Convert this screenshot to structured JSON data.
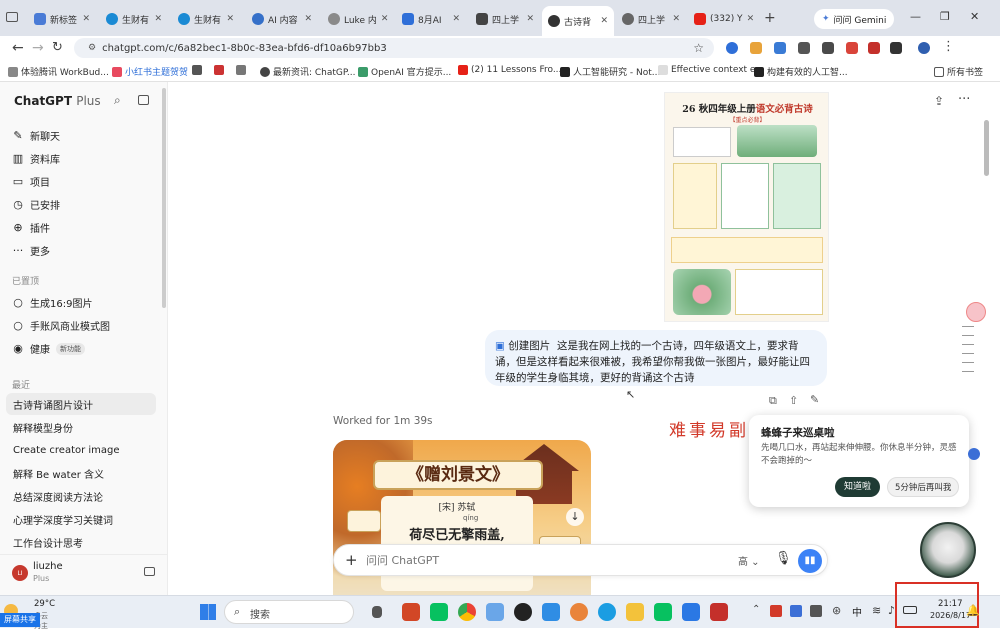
{
  "tabs": [
    {
      "label": "新标签"
    },
    {
      "label": "生财有"
    },
    {
      "label": "生财有"
    },
    {
      "label": "AI 内容"
    },
    {
      "label": "Luke 内"
    },
    {
      "label": "8月AI"
    },
    {
      "label": "四上学"
    },
    {
      "label": "古诗背"
    },
    {
      "label": "四上学"
    },
    {
      "label": "(332) Y"
    }
  ],
  "gemini_button": "问问 Gemini",
  "url": "chatgpt.com/c/6a82bec1-8b0c-83ea-bfd6-df10a6b97bb3",
  "bookmarks": [
    {
      "label": "体验腾讯 WorkBud..."
    },
    {
      "label": "小红书主题贺贺"
    },
    {
      "label": "最新资讯: ChatGP..."
    },
    {
      "label": "OpenAI 官方提示..."
    },
    {
      "label": "(2) 11 Lessons Fro..."
    },
    {
      "label": "人工智能研究 - Not..."
    },
    {
      "label": "Effective context e..."
    },
    {
      "label": "构建有效的人工智..."
    },
    {
      "label": "所有书签"
    }
  ],
  "sidebar": {
    "brand": "ChatGPT",
    "plan": "Plus",
    "nav": [
      {
        "label": "新聊天"
      },
      {
        "label": "资料库"
      },
      {
        "label": "项目"
      },
      {
        "label": "已安排"
      },
      {
        "label": "插件"
      },
      {
        "label": "更多"
      }
    ],
    "pinned_header": "已置顶",
    "pinned": [
      {
        "label": "生成16:9图片"
      },
      {
        "label": "手账风商业模式图"
      },
      {
        "label": "健康",
        "badge": "新功能"
      }
    ],
    "recent_header": "最近",
    "recent": [
      {
        "label": "古诗背诵图片设计"
      },
      {
        "label": "解释模型身份"
      },
      {
        "label": "Create creator image"
      },
      {
        "label": "解释 Be water 含义"
      },
      {
        "label": "总结深度阅读方法论"
      },
      {
        "label": "心理学深度学习关键词"
      },
      {
        "label": "工作台设计思考"
      }
    ],
    "user": {
      "name": "liuzhe",
      "plan": "Plus",
      "initials": "LI"
    }
  },
  "poster": {
    "title_a": "26 秋四年级上册",
    "title_b": "语文必背古诗",
    "subtitle": "【重点必背】"
  },
  "message": {
    "mode": "创建图片",
    "text": "这是我在网上找的一个古诗，四年级语文上，要求背诵，但是这样看起来很难被，我希望你帮我做一张图片，最好能让四年级的学生身临其境，更好的背诵这个古诗"
  },
  "worked_for": "Worked for 1m 39s",
  "watermark": "难事易副业",
  "image": {
    "title": "《赠刘景文》",
    "author": "[宋] 苏轼",
    "line1": "荷尽已无擎雨盖,",
    "pinyin": "qíng"
  },
  "composer": {
    "placeholder": "问问 ChatGPT",
    "mode": "高"
  },
  "notification": {
    "title": "蜂蜂子来巡桌啦",
    "body": "先喝几口水，再站起来伸伸腰。你休息半分钟，灵感不会跑掉的～",
    "primary": "知道啦",
    "secondary": "5分钟后再叫我"
  },
  "taskbar": {
    "weather": "29°C",
    "weather_sub": "多云为主",
    "share_label": "屏幕共享",
    "search": "搜索",
    "ime": "中",
    "time": "21:17",
    "date": "2026/8/17"
  }
}
